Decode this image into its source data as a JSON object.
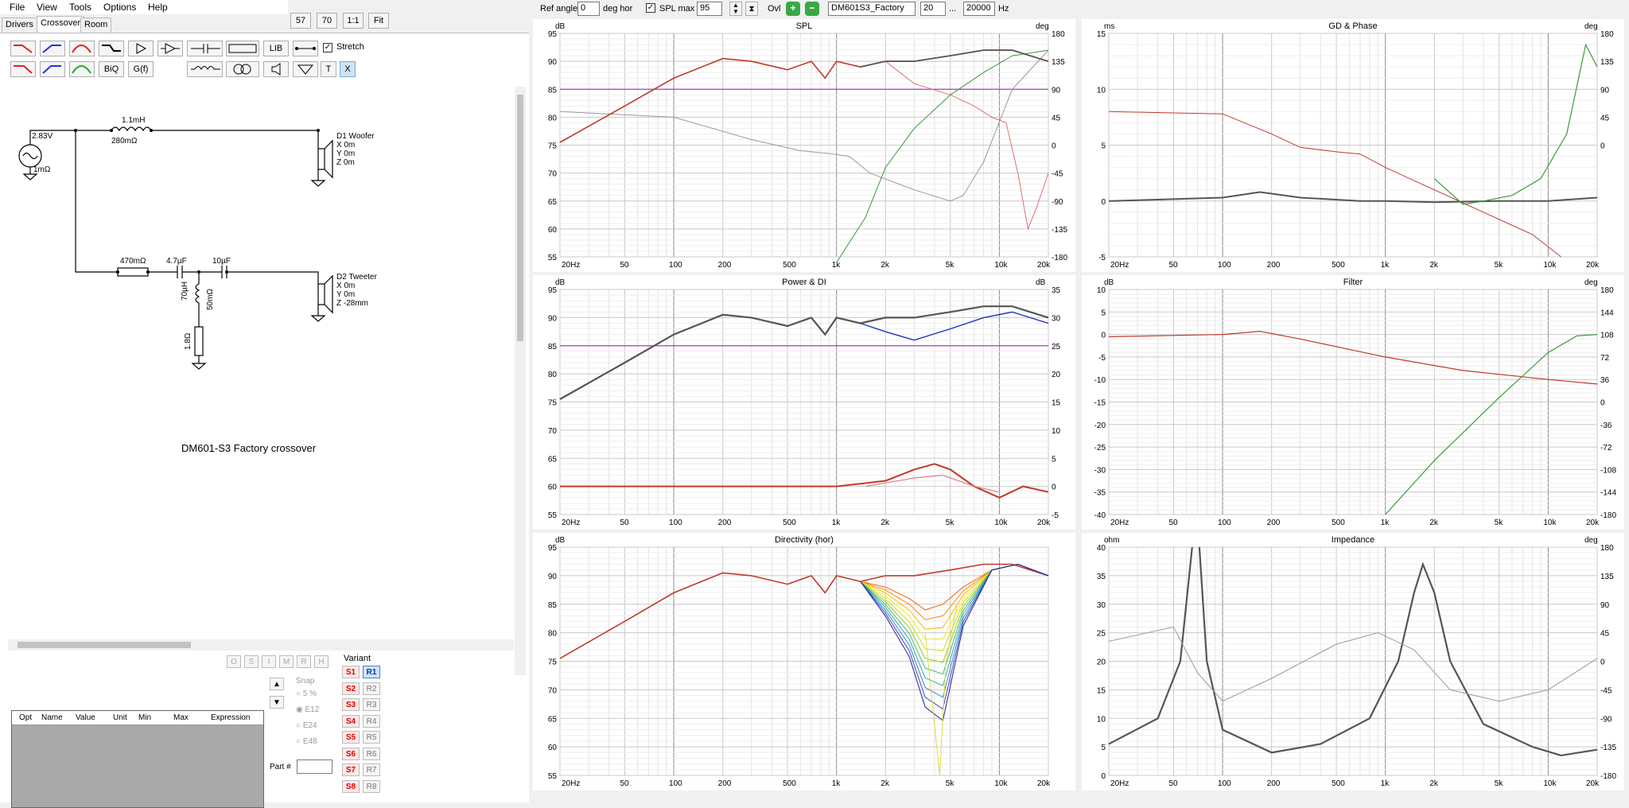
{
  "menu": [
    "File",
    "View",
    "Tools",
    "Options",
    "Help"
  ],
  "tabs": [
    "Drivers",
    "Crossover",
    "Room"
  ],
  "zoom": {
    "a": "57",
    "b": "70",
    "c": "1:1",
    "d": "Fit"
  },
  "toolbar": {
    "lib": "LIB",
    "stretch": "Stretch",
    "biq": "BiQ",
    "gf": "G(f)",
    "t": "T",
    "x": "X"
  },
  "schematic": {
    "source_v": "2.83V",
    "source_r": "1mΩ",
    "l1": "1.1mH",
    "l1r": "280mΩ",
    "woofer": [
      "D1 Woofer",
      "X 0m",
      "Y 0m",
      "Z 0m"
    ],
    "r1": "470mΩ",
    "c1": "4.7µF",
    "c2": "10µF",
    "l2": "70µH",
    "l2r": "50mΩ",
    "r2": "1.8Ω",
    "tweeter": [
      "D2 Tweeter",
      "X 0m",
      "Y 0m",
      "Z -28mm"
    ],
    "caption": "DM601-S3 Factory crossover"
  },
  "opt": {
    "letters": [
      "O",
      "S",
      "I",
      "M",
      "R",
      "H"
    ],
    "columns": [
      "Opt",
      "Name",
      "Value",
      "Unit",
      "Min",
      "Max",
      "Expression"
    ],
    "snap": "Snap",
    "snap_opts": [
      "5 %",
      "E12",
      "E24",
      "E48"
    ],
    "part": "Part #"
  },
  "variant": {
    "label": "Variant",
    "s": [
      "S1",
      "S2",
      "S3",
      "S4",
      "S5",
      "S6",
      "S7",
      "S8"
    ],
    "r": [
      "R1",
      "R2",
      "R3",
      "R4",
      "R5",
      "R6",
      "R7",
      "R8"
    ]
  },
  "top": {
    "ref_label": "Ref angle",
    "ref": "0",
    "deg_hor": "deg hor",
    "splmax_label": "SPL max",
    "splmax": "95",
    "ovl": "Ovl",
    "name": "DM601S3_Factory",
    "fmin": "20",
    "dots": "...",
    "fmax": "20000",
    "hz": "Hz"
  },
  "freq_ticks": [
    "20Hz",
    "50",
    "100",
    "200",
    "500",
    "1k",
    "2k",
    "5k",
    "10k",
    "20k"
  ],
  "charts": {
    "spl": {
      "title": "SPL",
      "lunit": "dB",
      "runit": "deg",
      "left": [
        "95",
        "90",
        "85",
        "80",
        "75",
        "70",
        "65",
        "60",
        "55"
      ],
      "right": [
        "180",
        "135",
        "90",
        "45",
        "0",
        "-45",
        "-90",
        "-135",
        "-180"
      ]
    },
    "gd": {
      "title": "GD & Phase",
      "lunit": "ms",
      "runit": "deg",
      "left": [
        "15",
        "10",
        "5",
        "0",
        "-5"
      ],
      "right": [
        "180",
        "135",
        "90",
        "45",
        "0",
        "-45",
        "-90",
        "-135",
        "-180"
      ]
    },
    "power": {
      "title": "Power & DI",
      "lunit": "dB",
      "runit": "dB",
      "left": [
        "95",
        "90",
        "85",
        "80",
        "75",
        "70",
        "65",
        "60",
        "55"
      ],
      "right": [
        "35",
        "30",
        "25",
        "20",
        "15",
        "10",
        "5",
        "0",
        "-5"
      ]
    },
    "filter": {
      "title": "Filter",
      "lunit": "dB",
      "runit": "deg",
      "left": [
        "10",
        "5",
        "0",
        "-5",
        "-10",
        "-15",
        "-20",
        "-25",
        "-30",
        "-35",
        "-40"
      ],
      "right": [
        "180",
        "144",
        "108",
        "72",
        "36",
        "0",
        "-36",
        "-72",
        "-108",
        "-144",
        "-180"
      ]
    },
    "dir": {
      "title": "Directivity (hor)",
      "lunit": "dB",
      "runit": "",
      "left": [
        "95",
        "90",
        "85",
        "80",
        "75",
        "70",
        "65",
        "60",
        "55"
      ],
      "right": []
    },
    "imp": {
      "title": "Impedance",
      "lunit": "ohm",
      "runit": "deg",
      "left": [
        "40",
        "35",
        "30",
        "25",
        "20",
        "15",
        "10",
        "5",
        "0"
      ],
      "right": [
        "180",
        "135",
        "90",
        "45",
        "0",
        "-45",
        "-90",
        "-135",
        "-180"
      ]
    }
  },
  "colors": {
    "red": "#c0392b",
    "green": "#3a9a3a",
    "gray": "#555555",
    "purple": "#b23cc4"
  }
}
